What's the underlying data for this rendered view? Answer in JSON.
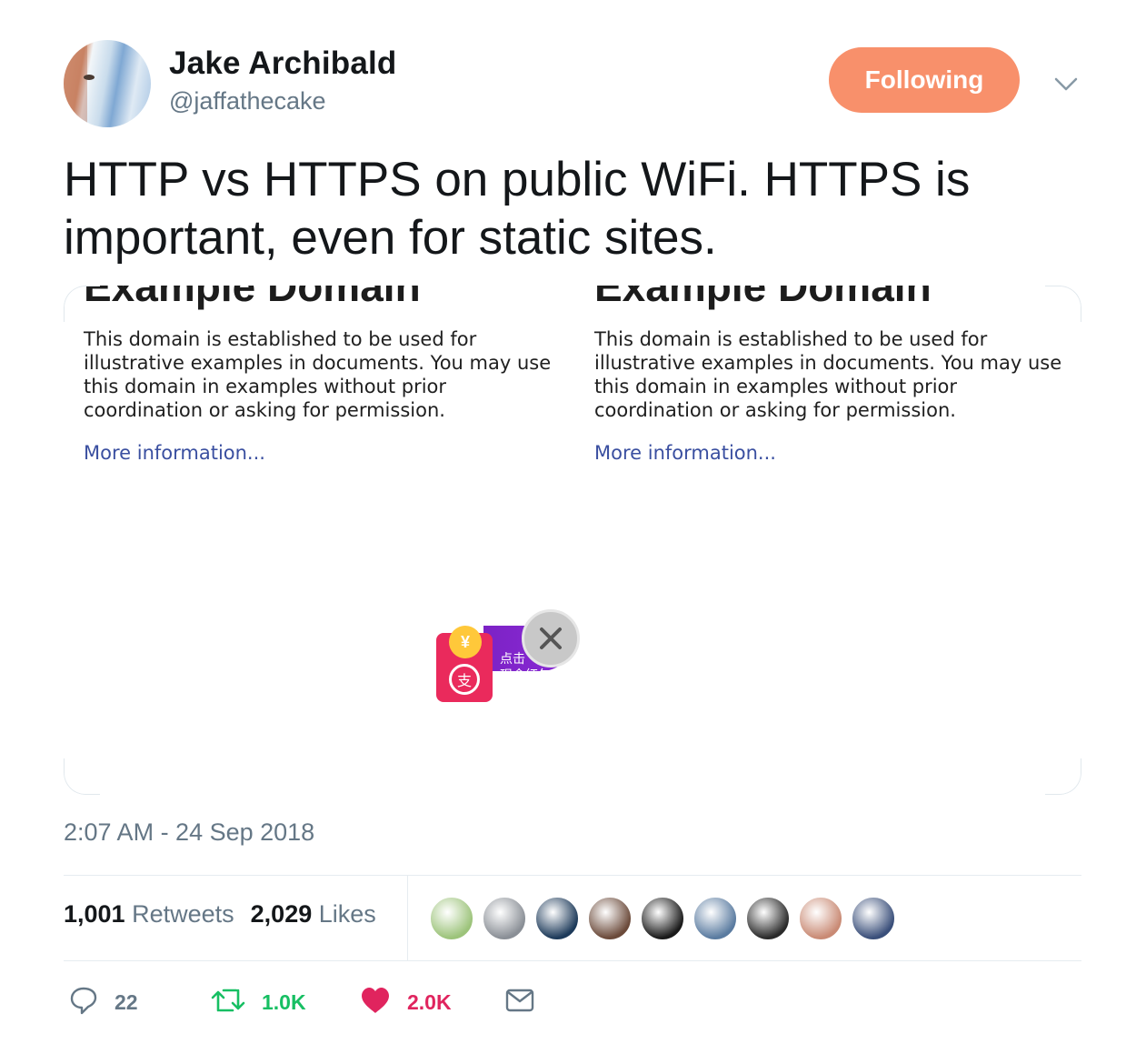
{
  "author": {
    "name": "Jake Archibald",
    "handle": "@jaffathecake"
  },
  "follow_button": {
    "label": "Following",
    "color": "#f8906b"
  },
  "tweet": {
    "text": "HTTP vs HTTPS on public WiFi. HTTPS is important, even for static sites.",
    "timestamp": "2:07 AM - 24 Sep 2018"
  },
  "media": {
    "left_panel": {
      "heading": "Example Domain",
      "body": "This domain is established to be used for illustrative examples in documents. You may use this domain in examples without prior coordination or asking for permission.",
      "link": "More information..."
    },
    "right_panel": {
      "heading": "Example Domain",
      "body": "This domain is established to be used for illustrative examples in documents. You may use this domain in examples without prior coordination or asking for permission.",
      "link": "More information..."
    },
    "injected_ad": {
      "line1": "点击",
      "line2": "现金红包",
      "coin_symbol": "¥",
      "pay_symbol": "支"
    }
  },
  "stats": {
    "retweets_count": "1,001",
    "retweets_label": "Retweets",
    "likes_count": "2,029",
    "likes_label": "Likes"
  },
  "liked_by_avatars": [
    {
      "name": "liker-avatar-cartoon",
      "color": "#9cc37a"
    },
    {
      "name": "liker-avatar-husky",
      "color": "#8a8f96"
    },
    {
      "name": "liker-avatar-earth",
      "color": "#1d3a5a"
    },
    {
      "name": "liker-avatar-face",
      "color": "#6b4a3a"
    },
    {
      "name": "liker-avatar-refugees",
      "color": "#1a1a1a"
    },
    {
      "name": "liker-avatar-man",
      "color": "#5a7ba0"
    },
    {
      "name": "liker-avatar-dark",
      "color": "#2a2a2a"
    },
    {
      "name": "liker-avatar-sunglasses",
      "color": "#c98a74"
    },
    {
      "name": "liker-avatar-space",
      "color": "#3a4f7a"
    }
  ],
  "actions": {
    "reply_count": "22",
    "retweet_count": "1.0K",
    "like_count": "2.0K",
    "retweet_color": "#17bf63",
    "like_color": "#e0245e"
  }
}
